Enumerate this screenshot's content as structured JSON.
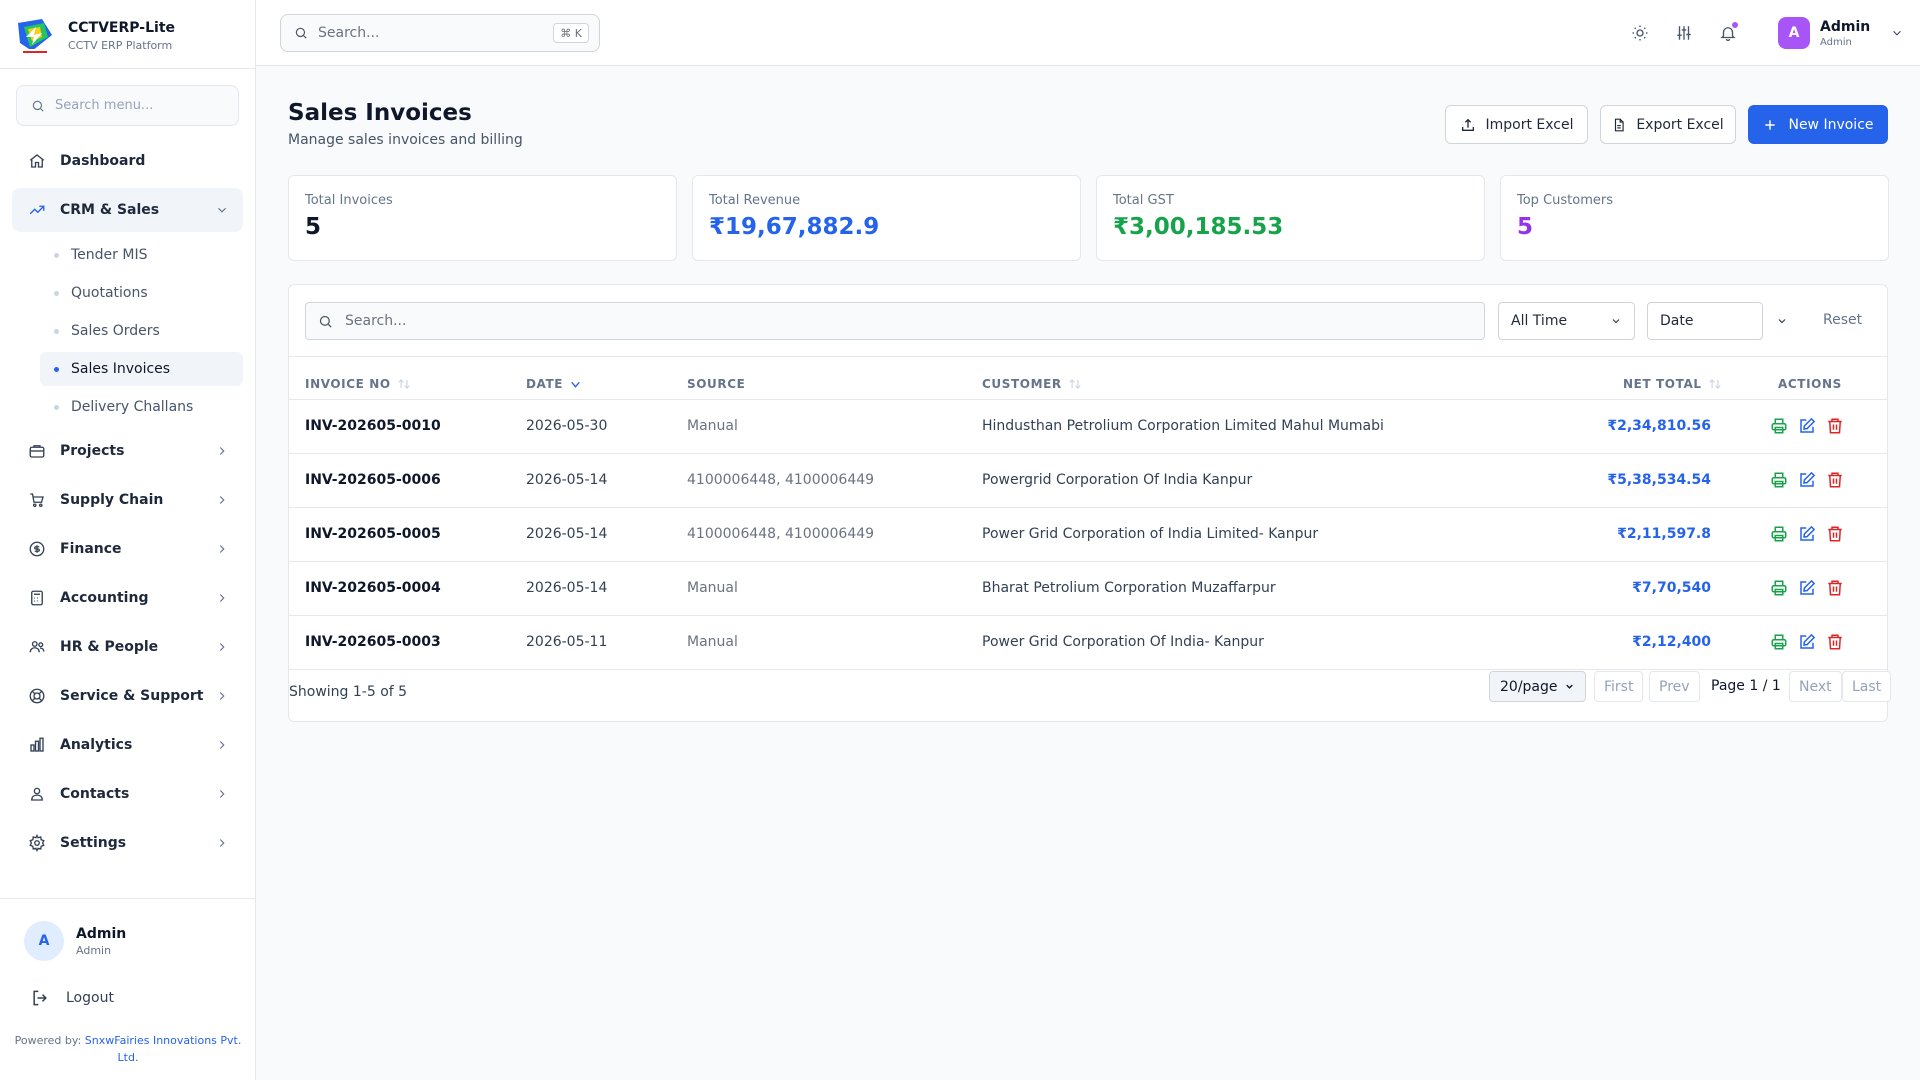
{
  "brand": {
    "name": "CCTVERP-Lite",
    "subtitle": "CCTV ERP Platform"
  },
  "sidebar": {
    "search_placeholder": "Search menu...",
    "items": [
      {
        "label": "Dashboard",
        "icon": "home-icon"
      },
      {
        "label": "CRM & Sales",
        "icon": "trending-up-icon"
      },
      {
        "label": "Projects",
        "icon": "briefcase-icon"
      },
      {
        "label": "Supply Chain",
        "icon": "cart-icon"
      },
      {
        "label": "Finance",
        "icon": "dollar-circle-icon"
      },
      {
        "label": "Accounting",
        "icon": "calculator-icon"
      },
      {
        "label": "HR & People",
        "icon": "users-icon"
      },
      {
        "label": "Service & Support",
        "icon": "lifebuoy-icon"
      },
      {
        "label": "Analytics",
        "icon": "bar-chart-icon"
      },
      {
        "label": "Contacts",
        "icon": "contacts-icon"
      },
      {
        "label": "Settings",
        "icon": "gear-icon"
      }
    ],
    "sub_items": [
      "Tender MIS",
      "Quotations",
      "Sales Orders",
      "Sales Invoices",
      "Delivery Challans"
    ],
    "active_sub": "Sales Invoices",
    "user": {
      "initial": "A",
      "name": "Admin",
      "role": "Admin"
    },
    "logout": "Logout",
    "powered_prefix": "Powered by: ",
    "powered_link": "SnxwFairies Innovations Pvt. Ltd."
  },
  "topbar": {
    "search_placeholder": "Search...",
    "shortcut": "⌘ K",
    "user": {
      "initial": "A",
      "name": "Admin",
      "role": "Admin"
    }
  },
  "page": {
    "title": "Sales Invoices",
    "subtitle": "Manage sales invoices and billing",
    "import_label": "Import Excel",
    "export_label": "Export Excel",
    "new_label": "New Invoice"
  },
  "stats": [
    {
      "label": "Total Invoices",
      "value": "5",
      "color": "#0f172a"
    },
    {
      "label": "Total Revenue",
      "value": "₹19,67,882.9",
      "color": "#2563eb"
    },
    {
      "label": "Total GST",
      "value": "₹3,00,185.53",
      "color": "#16a34a"
    },
    {
      "label": "Top Customers",
      "value": "5",
      "color": "#9333ea"
    }
  ],
  "filters": {
    "search_placeholder": "Search...",
    "period": "All Time",
    "sort_by": "Date",
    "reset": "Reset"
  },
  "table": {
    "headers": {
      "invoice_no": "INVOICE NO",
      "date": "DATE",
      "source": "SOURCE",
      "customer": "CUSTOMER",
      "net_total": "NET TOTAL",
      "actions": "ACTIONS"
    },
    "rows": [
      {
        "invoice_no": "INV-202605-0010",
        "date": "2026-05-30",
        "source": "Manual",
        "customer": "Hindusthan Petrolium Corporation Limited Mahul Mumabi",
        "net_total": "₹2,34,810.56"
      },
      {
        "invoice_no": "INV-202605-0006",
        "date": "2026-05-14",
        "source": "4100006448, 4100006449",
        "customer": "Powergrid Corporation Of India Kanpur",
        "net_total": "₹5,38,534.54"
      },
      {
        "invoice_no": "INV-202605-0005",
        "date": "2026-05-14",
        "source": "4100006448, 4100006449",
        "customer": "Power Grid Corporation of India Limited- Kanpur",
        "net_total": "₹2,11,597.8"
      },
      {
        "invoice_no": "INV-202605-0004",
        "date": "2026-05-14",
        "source": "Manual",
        "customer": "Bharat Petrolium Corporation Muzaffarpur",
        "net_total": "₹7,70,540"
      },
      {
        "invoice_no": "INV-202605-0003",
        "date": "2026-05-11",
        "source": "Manual",
        "customer": "Power Grid Corporation Of India- Kanpur",
        "net_total": "₹2,12,400"
      }
    ]
  },
  "pagination": {
    "showing": "Showing 1-5 of 5",
    "per_page": "20/page",
    "first": "First",
    "prev": "Prev",
    "page_info": "Page 1 / 1",
    "next": "Next",
    "last": "Last"
  },
  "colors": {
    "accent": "#2563eb",
    "print": "#16a34a",
    "edit": "#2563eb",
    "delete": "#dc2626"
  }
}
